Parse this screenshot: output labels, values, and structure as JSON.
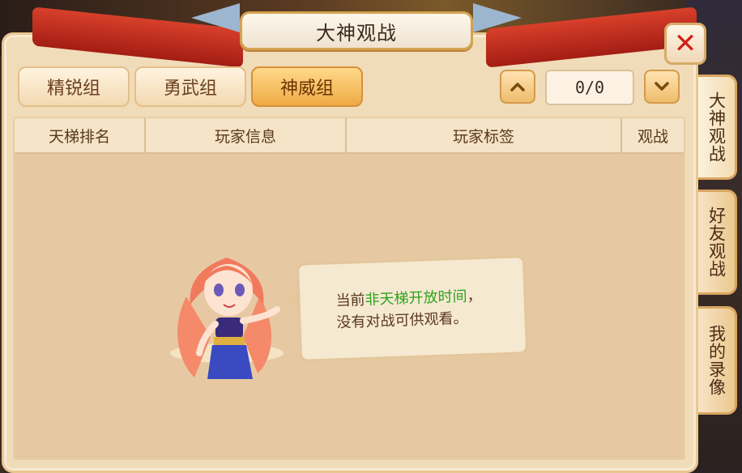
{
  "window": {
    "title": "大神观战"
  },
  "tabs": [
    {
      "label": "精锐组",
      "active": false
    },
    {
      "label": "勇武组",
      "active": false
    },
    {
      "label": "神威组",
      "active": true
    }
  ],
  "pager": {
    "value": "0/0"
  },
  "table": {
    "headers": [
      "天梯排名",
      "玩家信息",
      "玩家标签",
      "观战"
    ]
  },
  "empty_message": {
    "line1_prefix": "当前",
    "line1_highlight": "非天梯开放时间",
    "line1_suffix": "，",
    "line2": "没有对战可供观看。"
  },
  "side_tabs": [
    {
      "label": "大神观战",
      "active": true
    },
    {
      "label": "好友观战",
      "active": false
    },
    {
      "label": "我的录像",
      "active": false
    }
  ],
  "colors": {
    "highlight": "#2ea21c",
    "close": "#d22018",
    "active_tab": "#eeaa45"
  }
}
